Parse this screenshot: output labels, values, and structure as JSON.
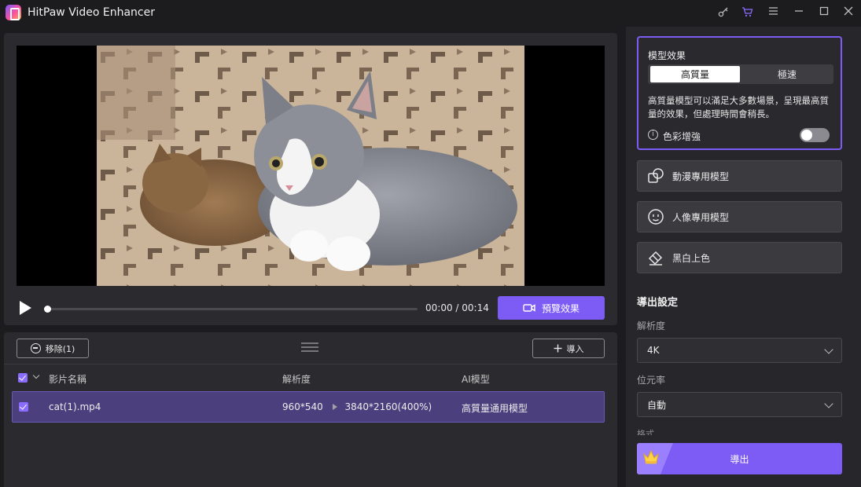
{
  "window": {
    "title": "HitPaw Video Enhancer"
  },
  "player": {
    "time": "00:00 / 00:14",
    "progress": 0,
    "preview_label": "預覽效果"
  },
  "list": {
    "remove_label": "移除(1)",
    "import_label": "導入",
    "headers": {
      "name": "影片名稱",
      "resolution": "解析度",
      "model": "AI模型"
    },
    "rows": [
      {
        "name": "cat(1).mp4",
        "res_from": "960*540",
        "res_to": "3840*2160(400%)",
        "model": "高質量通用模型",
        "checked": true
      }
    ]
  },
  "model_panel": {
    "title": "模型效果",
    "mode_high": "高質量",
    "mode_fast": "極速",
    "description": "高質量模型可以滿足大多數場景，呈現最高質量的效果，但處理時間會稍長。",
    "color_label": "色彩增強",
    "color_enabled": false
  },
  "models": {
    "anime": "動漫專用模型",
    "portrait": "人像專用模型",
    "colorize": "黑白上色"
  },
  "export": {
    "section_title": "導出設定",
    "resolution_label": "解析度",
    "resolution_value": "4K",
    "bitrate_label": "位元率",
    "bitrate_value": "自動",
    "format_label": "格式",
    "export_label": "導出"
  },
  "colors": {
    "accent": "#7c5cf4",
    "row_highlight": "#4b3f7d"
  }
}
